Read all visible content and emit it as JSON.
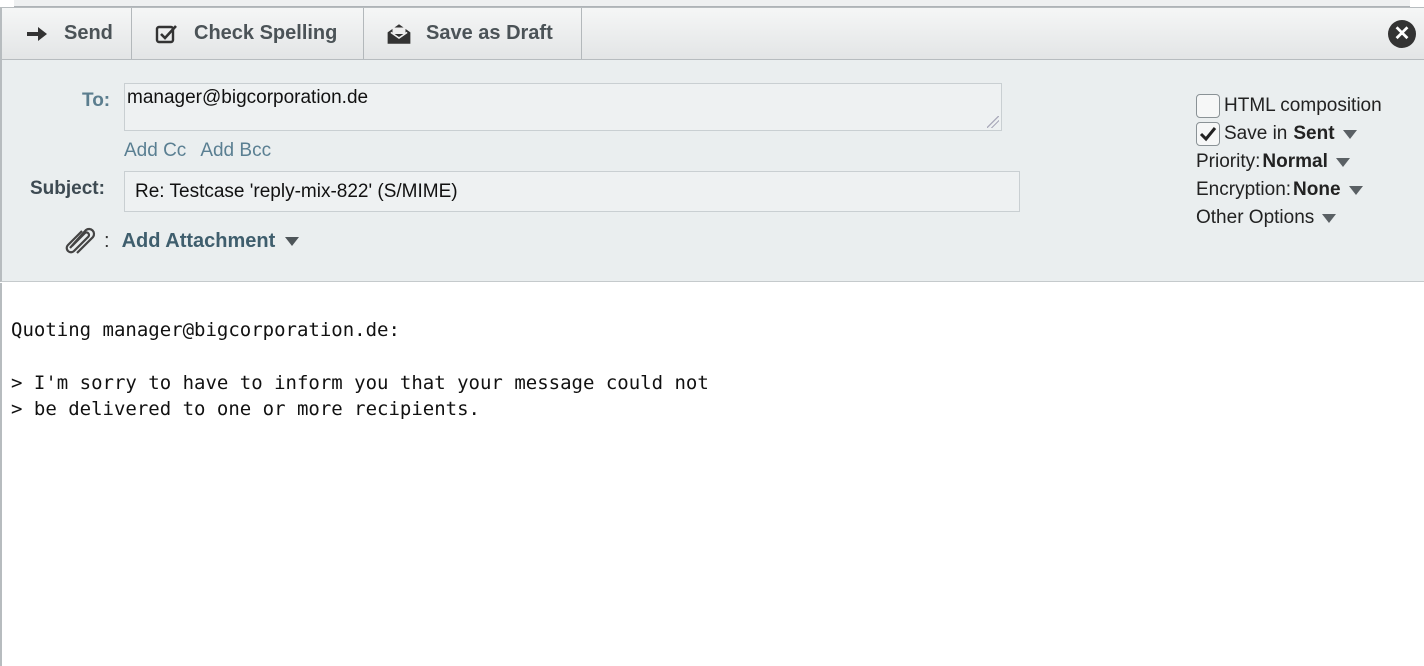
{
  "toolbar": {
    "send_label": "Send",
    "check_spelling_label": "Check Spelling",
    "save_draft_label": "Save as Draft",
    "icons": [
      "arrow-right-icon",
      "check-spelling-icon",
      "envelope-draft-icon",
      "close-icon"
    ]
  },
  "compose": {
    "to_label": "To:",
    "to_value": "manager@bigcorporation.de",
    "add_cc": "Add Cc",
    "add_bcc": "Add Bcc",
    "subject_label": "Subject:",
    "subject_value": "Re: Testcase 'reply-mix-822' (S/MIME)",
    "attach_colon": ":",
    "add_attachment": "Add Attachment"
  },
  "options": {
    "html_composition": "HTML composition",
    "html_composition_checked": false,
    "save_in_prefix": "Save in",
    "save_in_value": "Sent",
    "save_in_checked": true,
    "priority_label": "Priority:",
    "priority_value": "Normal",
    "encryption_label": "Encryption:",
    "encryption_value": "None",
    "other_options": "Other Options"
  },
  "message": {
    "lines": [
      "Quoting manager@bigcorporation.de:",
      "",
      "> I'm sorry to have to inform you that your message could not",
      "> be delivered to one or more recipients."
    ]
  },
  "colors": {
    "header_bg": "#eaeeef",
    "link": "#5a7f92",
    "toolbar_text": "#4b5357"
  }
}
